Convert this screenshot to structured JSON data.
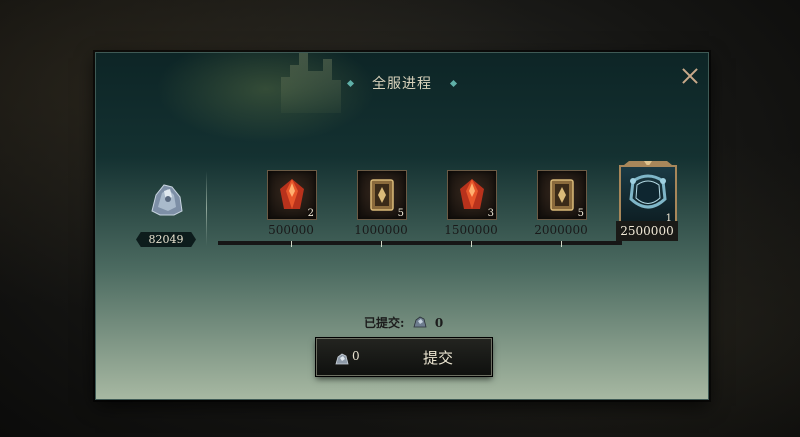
{
  "dialog": {
    "title": "全服进程",
    "close_icon": "close-icon"
  },
  "currency": {
    "icon": "ore-crystal-icon",
    "amount": "82049"
  },
  "milestones": [
    {
      "threshold": "500000",
      "reward_icon": "red-crystal-icon",
      "count": "2"
    },
    {
      "threshold": "1000000",
      "reward_icon": "scroll-card-icon",
      "count": "5"
    },
    {
      "threshold": "1500000",
      "reward_icon": "red-crystal-icon",
      "count": "3"
    },
    {
      "threshold": "2000000",
      "reward_icon": "scroll-card-icon",
      "count": "5"
    },
    {
      "threshold": "2500000",
      "reward_icon": "blue-frame-icon",
      "count": "1"
    }
  ],
  "progress": 0,
  "submitted": {
    "label": "已提交:",
    "icon": "ore-crystal-icon",
    "value": "0"
  },
  "submit_button": {
    "icon": "ore-crystal-icon",
    "count": "0",
    "label": "提交"
  },
  "colors": {
    "accent": "#5fb0a8",
    "final_border": "#a8875a"
  }
}
